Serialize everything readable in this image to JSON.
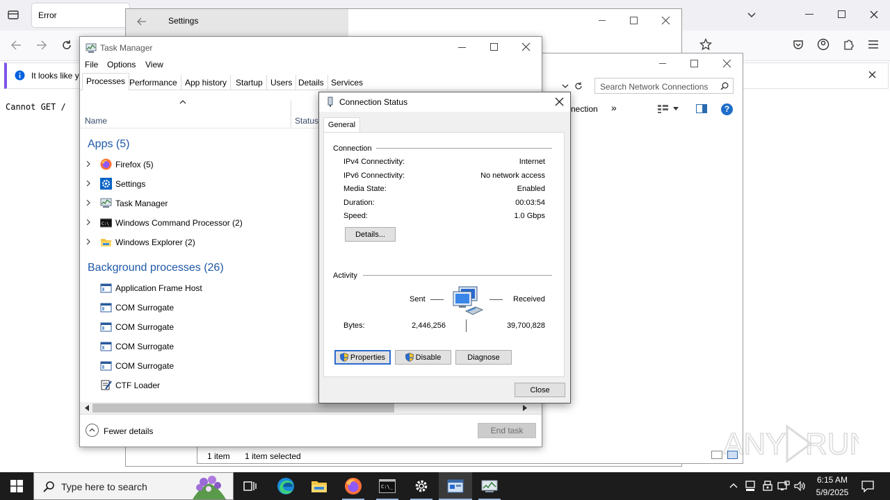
{
  "firefox": {
    "tab_title": "Error",
    "info_text": "It looks like y",
    "page_text": "Cannot GET /"
  },
  "settings": {
    "title": "Settings"
  },
  "network": {
    "search_placeholder": "Search Network Connections",
    "toolbar_fragment": "nection",
    "more": "»",
    "status_items": "1 item",
    "status_selected": "1 item selected"
  },
  "taskmgr": {
    "title": "Task Manager",
    "menu": [
      "File",
      "Options",
      "View"
    ],
    "tabs": [
      "Processes",
      "Performance",
      "App history",
      "Startup",
      "Users",
      "Details",
      "Services"
    ],
    "col_name": "Name",
    "col_status": "Status",
    "apps_header": "Apps (5)",
    "apps": [
      "Firefox (5)",
      "Settings",
      "Task Manager",
      "Windows Command Processor (2)",
      "Windows Explorer (2)"
    ],
    "bg_header": "Background processes (26)",
    "bg": [
      "Application Frame Host",
      "COM Surrogate",
      "COM Surrogate",
      "COM Surrogate",
      "COM Surrogate",
      "CTF Loader"
    ],
    "fewer_details": "Fewer details",
    "end_task": "End task"
  },
  "status_dialog": {
    "title": "Connection Status",
    "tab": "General",
    "connection_label": "Connection",
    "rows": [
      {
        "k": "IPv4 Connectivity:",
        "v": "Internet"
      },
      {
        "k": "IPv6 Connectivity:",
        "v": "No network access"
      },
      {
        "k": "Media State:",
        "v": "Enabled"
      },
      {
        "k": "Duration:",
        "v": "00:03:54"
      },
      {
        "k": "Speed:",
        "v": "1.0 Gbps"
      }
    ],
    "details_btn": "Details...",
    "activity_label": "Activity",
    "sent": "Sent",
    "received": "Received",
    "bytes_label": "Bytes:",
    "bytes_sent": "2,446,256",
    "bytes_received": "39,700,828",
    "properties_btn": "Properties",
    "disable_btn": "Disable",
    "diagnose_btn": "Diagnose",
    "close_btn": "Close"
  },
  "taskbar": {
    "search_placeholder": "Type here to search",
    "time": "6:15 AM",
    "date": "5/9/2025"
  },
  "watermark": "ANY RUN"
}
